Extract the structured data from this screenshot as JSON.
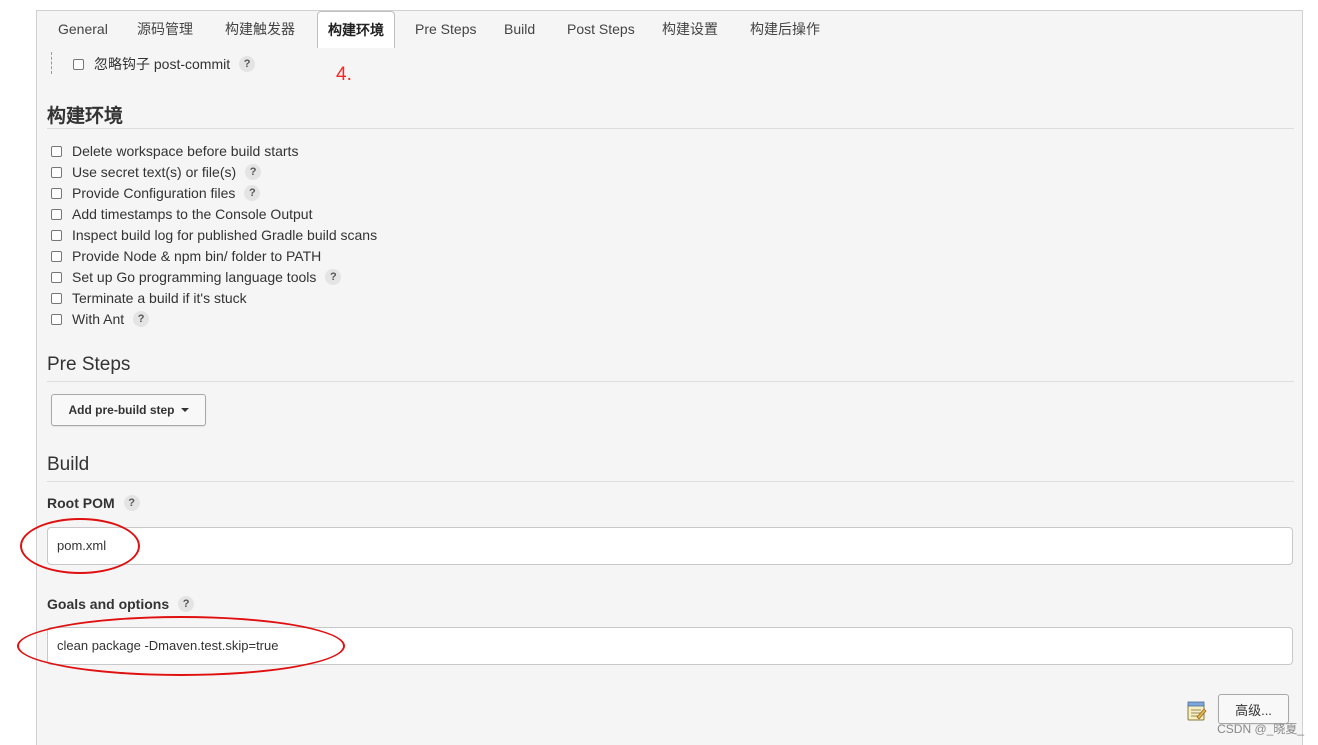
{
  "tabs": [
    {
      "label": "General",
      "active": false
    },
    {
      "label": "源码管理",
      "active": false
    },
    {
      "label": "构建触发器",
      "active": false
    },
    {
      "label": "构建环境",
      "active": true
    },
    {
      "label": "Pre Steps",
      "active": false
    },
    {
      "label": "Build",
      "active": false
    },
    {
      "label": "Post Steps",
      "active": false
    },
    {
      "label": "构建设置",
      "active": false
    },
    {
      "label": "构建后操作",
      "active": false
    }
  ],
  "trigger_option": {
    "label": "忽略钩子 post-commit",
    "checked": false,
    "help": "?"
  },
  "annotation": {
    "number": "4."
  },
  "build_env": {
    "title": "构建环境",
    "options": [
      {
        "label": "Delete workspace before build starts",
        "checked": false,
        "help": ""
      },
      {
        "label": "Use secret text(s) or file(s)",
        "checked": false,
        "help": "?"
      },
      {
        "label": "Provide Configuration files",
        "checked": false,
        "help": "?"
      },
      {
        "label": "Add timestamps to the Console Output",
        "checked": false,
        "help": ""
      },
      {
        "label": "Inspect build log for published Gradle build scans",
        "checked": false,
        "help": ""
      },
      {
        "label": "Provide Node & npm bin/ folder to PATH",
        "checked": false,
        "help": ""
      },
      {
        "label": "Set up Go programming language tools",
        "checked": false,
        "help": "?"
      },
      {
        "label": "Terminate a build if it's stuck",
        "checked": false,
        "help": ""
      },
      {
        "label": "With Ant",
        "checked": false,
        "help": "?"
      }
    ]
  },
  "pre_steps": {
    "title": "Pre Steps",
    "add_button": "Add pre-build step"
  },
  "build": {
    "title": "Build",
    "root_pom": {
      "label": "Root POM",
      "help": "?",
      "value": "pom.xml"
    },
    "goals": {
      "label": "Goals and options",
      "help": "?",
      "value": "clean package -Dmaven.test.skip=true"
    },
    "advanced_button": "高级..."
  },
  "watermark": "CSDN @_晓夏_",
  "colors": {
    "annotation_red": "#e01010",
    "panel_bg": "#f5f5f5"
  }
}
